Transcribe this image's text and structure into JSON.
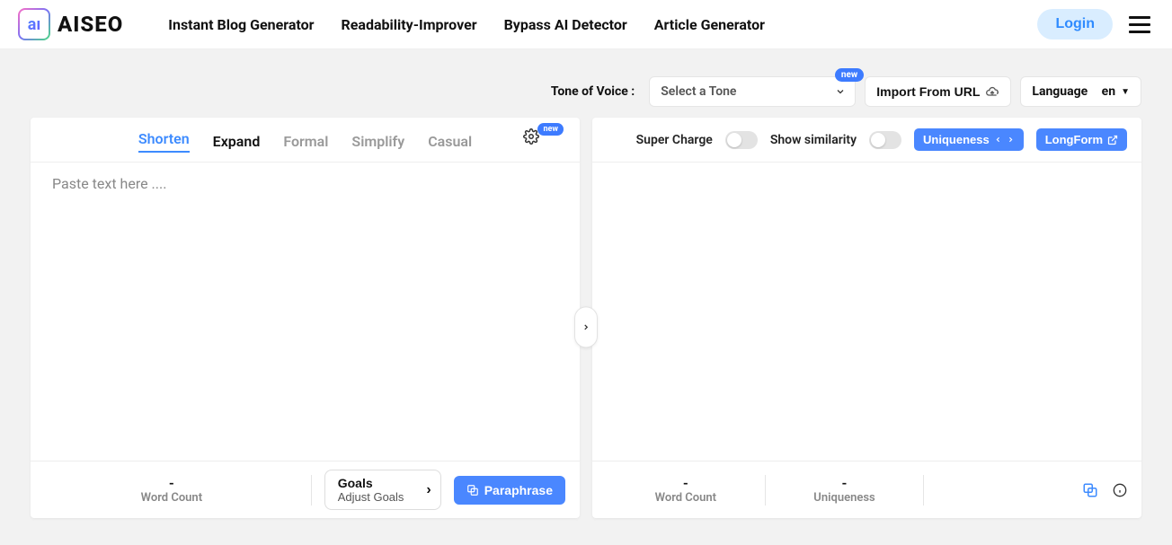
{
  "brand": "AISEO",
  "nav": {
    "instant_blog": "Instant Blog Generator",
    "readability": "Readability-Improver",
    "bypass": "Bypass AI Detector",
    "article": "Article Generator"
  },
  "header": {
    "login": "Login"
  },
  "controls": {
    "tone_label": "Tone of Voice :",
    "tone_placeholder": "Select a Tone",
    "new_badge": "new",
    "import_url": "Import From URL",
    "language_label": "Language",
    "language_value": "en"
  },
  "left": {
    "tabs": {
      "shorten": "Shorten",
      "expand": "Expand",
      "formal": "Formal",
      "simplify": "Simplify",
      "casual": "Casual"
    },
    "gear_badge": "new",
    "editor_placeholder": "Paste text here ....",
    "footer": {
      "word_count_val": "-",
      "word_count_lbl": "Word Count",
      "goals_title": "Goals",
      "goals_sub": "Adjust Goals",
      "paraphrase": "Paraphrase"
    }
  },
  "right": {
    "super_charge": "Super Charge",
    "show_similarity": "Show similarity",
    "uniqueness_btn": "Uniqueness",
    "longform_btn": "LongForm",
    "footer": {
      "word_count_val": "-",
      "word_count_lbl": "Word Count",
      "uniqueness_val": "-",
      "uniqueness_lbl": "Uniqueness"
    }
  }
}
